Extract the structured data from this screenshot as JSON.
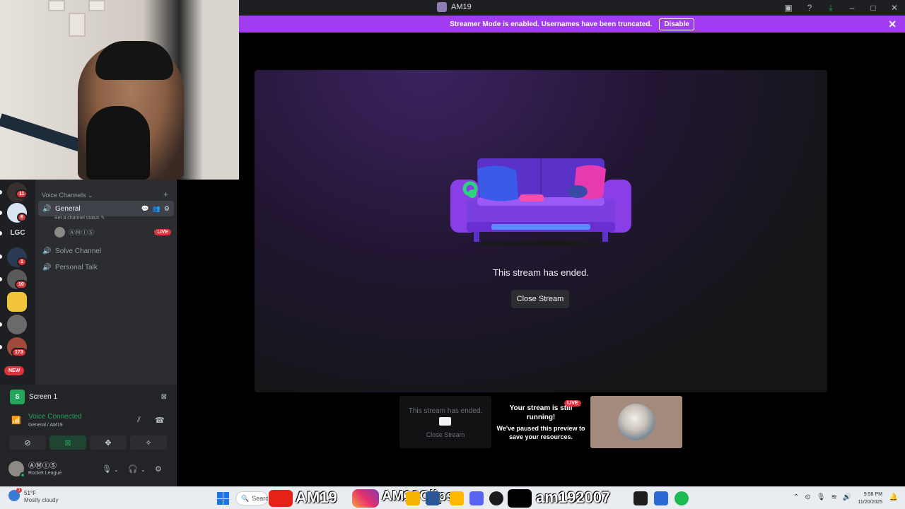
{
  "window": {
    "title": "AM19",
    "controls": [
      "inbox-icon",
      "help-icon",
      "download-icon",
      "minimize-icon",
      "maximize-icon",
      "close-icon"
    ]
  },
  "banner": {
    "text": "Streamer Mode is enabled. Usernames have been truncated.",
    "disable_label": "Disable",
    "color": "#a23cf0"
  },
  "stream": {
    "ended_text": "This stream has ended.",
    "close_label": "Close Stream"
  },
  "previews": {
    "ended_text": "This stream has ended.",
    "close_label": "Close Stream",
    "paused_title": "Your stream is still running!",
    "live_badge": "LIVE",
    "paused_sub": "We've paused this preview to save your resources."
  },
  "rail": {
    "badges": [
      "11",
      "6",
      "1",
      "10",
      "173"
    ],
    "lgc_label": "LGC",
    "new_label": "NEW"
  },
  "channels": {
    "category": "Voice Channels",
    "general": "General",
    "status_placeholder": "Set a channel status",
    "member_name": "ⒶⓂⒾⓈ",
    "live_badge": "LIVE",
    "solve": "Solve Channel",
    "personal": "Personal Talk"
  },
  "panel": {
    "screen_label": "Screen 1",
    "voice_status": "Voice Connected",
    "voice_sub": "General / AM19",
    "user_name": "ⒶⓂⒾⓈ",
    "user_status": "Rocket League",
    "accent_green": "#23a55a"
  },
  "taskbar": {
    "temperature": "51°F",
    "condition": "Mostly cloudy",
    "weather_badge": "1",
    "search_label": "Search",
    "overlay_youtube": "AM19",
    "overlay_instagram": "AM19Clips",
    "overlay_tiktok": "am192007",
    "time": "9:58 PM",
    "date": "11/20/2025"
  }
}
